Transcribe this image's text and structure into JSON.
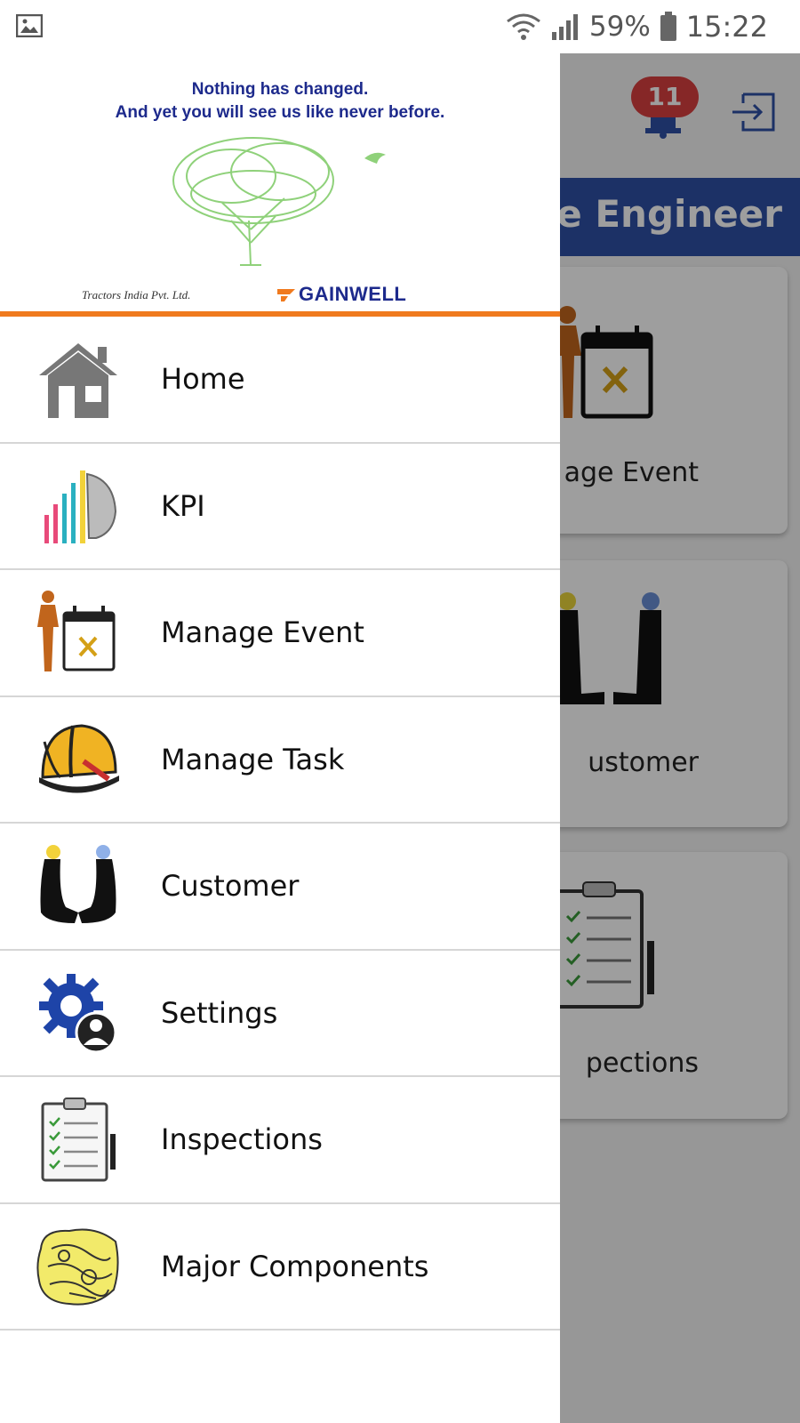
{
  "status_bar": {
    "battery_percent": "59%",
    "time": "15:22",
    "icons": [
      "image-icon",
      "wifi-icon",
      "signal-icon",
      "battery-icon"
    ]
  },
  "background_app": {
    "notification_count": "11",
    "role_title": "ice Engineer",
    "cards": [
      {
        "label": "age Event",
        "icon": "manage-event-icon"
      },
      {
        "label": "ustomer",
        "icon": "customer-icon"
      },
      {
        "label": "pections",
        "icon": "inspections-icon"
      }
    ]
  },
  "drawer": {
    "banner": {
      "tagline_line1": "Nothing has changed.",
      "tagline_line2": "And yet you will see us like never before.",
      "company": "Tractors India Pvt. Ltd.",
      "brand": "GAINWELL"
    },
    "menu": [
      {
        "label": "Home",
        "icon": "home-icon"
      },
      {
        "label": "KPI",
        "icon": "kpi-chart-icon"
      },
      {
        "label": "Manage Event",
        "icon": "manage-event-icon"
      },
      {
        "label": "Manage Task",
        "icon": "hard-hat-icon"
      },
      {
        "label": "Customer",
        "icon": "handshake-icon"
      },
      {
        "label": "Settings",
        "icon": "settings-user-icon"
      },
      {
        "label": "Inspections",
        "icon": "clipboard-icon"
      },
      {
        "label": "Major Components",
        "icon": "component-icon"
      }
    ]
  },
  "colors": {
    "accent_blue": "#2e4fa5",
    "brand_navy": "#1d2a8c",
    "banner_divider_orange": "#f07a1e",
    "badge_red": "#d94040"
  }
}
